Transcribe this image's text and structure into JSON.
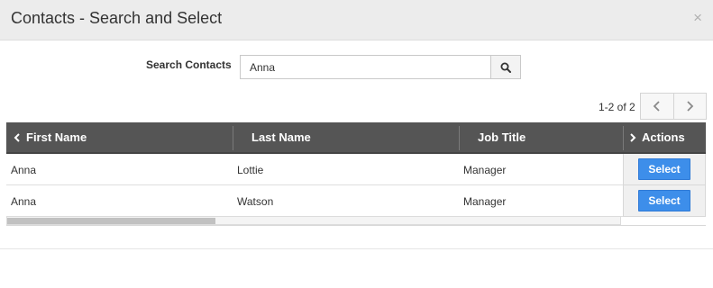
{
  "dialog": {
    "title": "Contacts - Search and Select",
    "close_glyph": "×"
  },
  "search": {
    "label": "Search Contacts",
    "value": "Anna",
    "icon": "search-icon"
  },
  "pager": {
    "text": "1-2 of 2",
    "prev_icon": "chevron-left-icon",
    "next_icon": "chevron-right-icon"
  },
  "table": {
    "columns": [
      "First Name",
      "Last Name",
      "Job Title",
      "Actions"
    ],
    "rows": [
      {
        "first": "Anna",
        "last": "Lottie",
        "title": "Manager",
        "action": "Select"
      },
      {
        "first": "Anna",
        "last": "Watson",
        "title": "Manager",
        "action": "Select"
      }
    ]
  },
  "colors": {
    "header_bg": "#555555",
    "select_button": "#3d8eea",
    "dialog_header": "#ececec"
  }
}
